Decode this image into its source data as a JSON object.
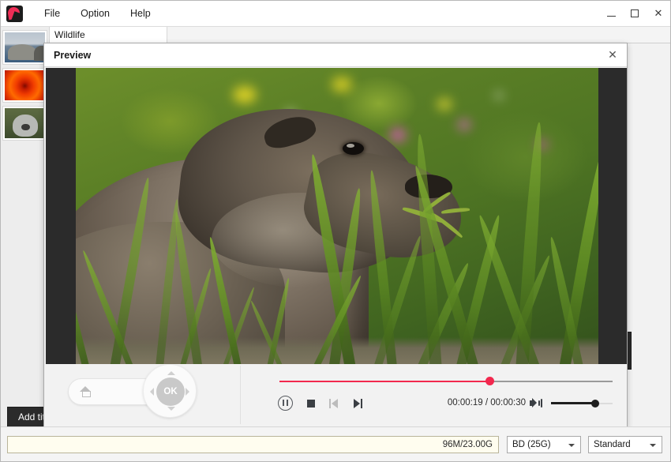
{
  "window": {
    "app_icon": "app-logo-icon",
    "menus": [
      "File",
      "Option",
      "Help"
    ],
    "controls": {
      "minimize": "minimize-icon",
      "maximize": "maximize-icon",
      "close": "✕"
    }
  },
  "sidebar": {
    "thumbnails": [
      {
        "name": "thumbnail-seals",
        "caption": ""
      },
      {
        "name": "thumbnail-flower",
        "caption": ""
      },
      {
        "name": "thumbnail-koala",
        "caption": ""
      }
    ],
    "add_title_button": "Add title"
  },
  "tabs": [
    {
      "label": "Wildlife",
      "active": true
    }
  ],
  "dialog": {
    "title": "Preview",
    "close_label": "✕",
    "video": {
      "subject": "marmot in a meadow",
      "letterbox_color": "#2b2b2b"
    },
    "navwheel": {
      "home_label": "home-icon",
      "ok_label": "OK",
      "menu_label": "menu-icon",
      "up": "▲",
      "down": "▼",
      "left": "◀",
      "right": "▶"
    },
    "player": {
      "seek_percent": 63,
      "accent_color": "#f2284e",
      "pause_label": "pause-icon",
      "stop_label": "stop-icon",
      "prev_label": "previous-icon",
      "next_label": "next-icon",
      "time": "00:00:19 / 00:00:30",
      "current_time": "00:00:19",
      "total_time": "00:00:30",
      "volume_icon": "speaker-icon",
      "volume_percent": 72
    }
  },
  "statusbar": {
    "capacity_text": "96M/23.00G",
    "disc_type": "BD (25G)",
    "quality": "Standard"
  }
}
